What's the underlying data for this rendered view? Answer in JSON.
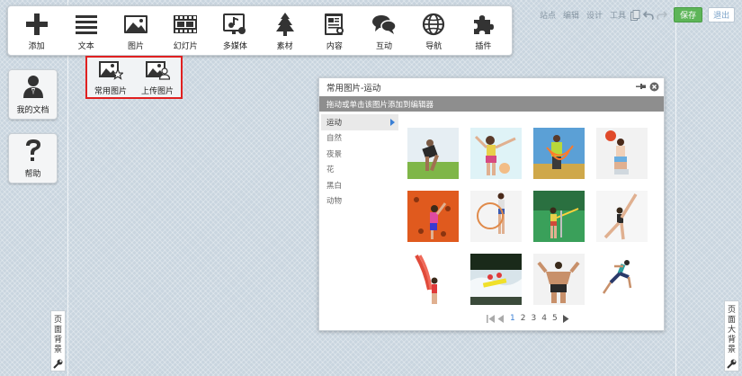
{
  "toolbar": {
    "items": [
      {
        "label": "添加",
        "icon": "plus-icon"
      },
      {
        "label": "文本",
        "icon": "text-lines-icon"
      },
      {
        "label": "图片",
        "icon": "image-icon"
      },
      {
        "label": "幻灯片",
        "icon": "filmstrip-icon"
      },
      {
        "label": "多媒体",
        "icon": "music-screen-icon"
      },
      {
        "label": "素材",
        "icon": "tree-icon"
      },
      {
        "label": "内容",
        "icon": "document-icon"
      },
      {
        "label": "互动",
        "icon": "chat-bubbles-icon"
      },
      {
        "label": "导航",
        "icon": "globe-icon"
      },
      {
        "label": "插件",
        "icon": "puzzle-icon"
      }
    ]
  },
  "top_links": {
    "site": "站点",
    "edit": "编辑",
    "design": "设计",
    "tools": "工具",
    "save": "保存",
    "exit": "退出"
  },
  "image_submenu": {
    "common": "常用图片",
    "upload": "上传图片"
  },
  "side": {
    "my_docs": "我的文档",
    "help": "帮助"
  },
  "tabs": {
    "page_bg": "页面背景",
    "page_big_bg": "页面大背景"
  },
  "panel": {
    "title": "常用图片-运动",
    "hint": "拖动或单击该图片添加到编辑器",
    "categories": [
      "运动",
      "自然",
      "夜景",
      "花",
      "黑白",
      "动物"
    ],
    "pager": {
      "pages": [
        "1",
        "2",
        "3",
        "4",
        "5"
      ],
      "current": "1"
    }
  },
  "colors": {
    "accent_blue": "#3a7fd5",
    "save_green": "#5db558",
    "highlight_red": "#e02020",
    "hint_bar": "#8e8e8e"
  }
}
